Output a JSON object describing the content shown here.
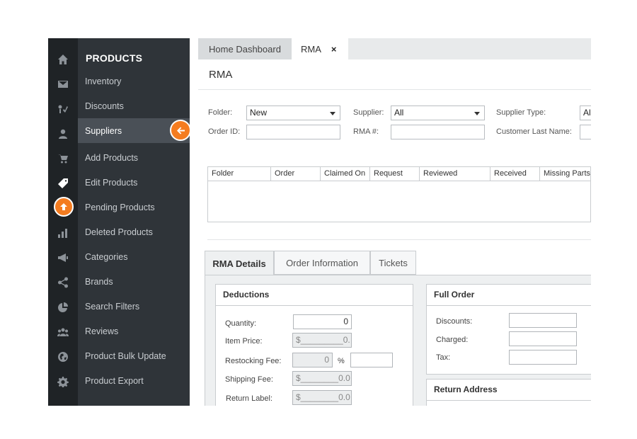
{
  "rail_icons": [
    "home-icon",
    "mail-icon",
    "tools-icon",
    "user-icon",
    "cart-icon",
    "tag-icon",
    "upload-icon",
    "bar-chart-icon",
    "megaphone-icon",
    "share-icon",
    "pie-chart-icon",
    "users-icon",
    "globe-icon",
    "settings-gear-icon"
  ],
  "menu": {
    "title": "PRODUCTS",
    "items": [
      {
        "label": "Inventory"
      },
      {
        "label": "Discounts"
      },
      {
        "label": "Suppliers"
      },
      {
        "label": "Add Products"
      },
      {
        "label": "Edit Products"
      },
      {
        "label": "Pending Products"
      },
      {
        "label": "Deleted Products"
      },
      {
        "label": "Categories"
      },
      {
        "label": "Brands"
      },
      {
        "label": "Search Filters"
      },
      {
        "label": "Reviews"
      },
      {
        "label": "Product Bulk Update"
      },
      {
        "label": "Product Export"
      }
    ],
    "active": "Suppliers"
  },
  "tabs": {
    "home": "Home Dashboard",
    "rma": "RMA",
    "close": "×"
  },
  "page_title": "RMA",
  "filters": {
    "folder_label": "Folder:",
    "folder_value": "New",
    "supplier_label": "Supplier:",
    "supplier_value": "All",
    "supplier_type_label": "Supplier Type:",
    "supplier_type_value": "All",
    "order_id_label": "Order ID:",
    "order_id_value": "",
    "rma_label": "RMA #:",
    "rma_value": "",
    "customer_last_name_label": "Customer Last Name:",
    "customer_last_name_value": ""
  },
  "grid": {
    "columns": [
      "Folder",
      "Order",
      "Claimed On",
      "Request",
      "Reviewed",
      "Received",
      "Missing Parts"
    ]
  },
  "detail_tabs": [
    "RMA Details",
    "Order Information",
    "Tickets"
  ],
  "deductions": {
    "title": "Deductions",
    "quantity_label": "Quantity:",
    "quantity_value": "0",
    "item_price_label": "Item Price:",
    "item_price_value": "$_________0.",
    "restocking_fee_label": "Restocking Fee:",
    "restocking_fee_value": "0",
    "percent_sign": "%",
    "restocking_extra_value": "",
    "shipping_fee_label": "Shipping Fee:",
    "shipping_fee_value": "$________0.0",
    "return_label_label": "Return Label:",
    "return_label_value": "$________0.0"
  },
  "full_order": {
    "title": "Full Order",
    "discounts_label": "Discounts:",
    "discounts_value": "",
    "charged_label": "Charged:",
    "charged_value": "",
    "tax_label": "Tax:",
    "tax_value": ""
  },
  "return_address": {
    "title": "Return Address"
  },
  "colors": {
    "accent": "#f47c20",
    "rail": "#1f2326",
    "menu": "#2f3439",
    "menu_active": "#4a5057"
  }
}
